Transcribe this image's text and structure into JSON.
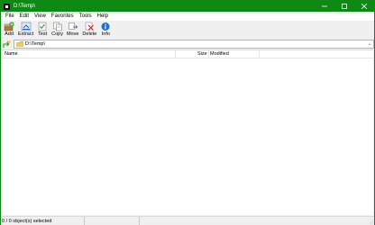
{
  "window": {
    "title": "D:\\Temp\\",
    "controls": [
      "minimize",
      "maximize",
      "close"
    ]
  },
  "menu": {
    "items": [
      "File",
      "Edit",
      "View",
      "Favorites",
      "Tools",
      "Help"
    ]
  },
  "toolbar": {
    "buttons": [
      {
        "label": "Add",
        "icon": "add-icon"
      },
      {
        "label": "Extract",
        "icon": "extract-icon"
      },
      {
        "label": "Test",
        "icon": "test-icon"
      },
      {
        "label": "Copy",
        "icon": "copy-icon"
      },
      {
        "label": "Move",
        "icon": "move-icon"
      },
      {
        "label": "Delete",
        "icon": "delete-icon"
      },
      {
        "label": "Info",
        "icon": "info-icon"
      }
    ]
  },
  "address": {
    "path": "D:\\Temp\\"
  },
  "list": {
    "columns": [
      "Name",
      "Size",
      "Modified"
    ]
  },
  "status": {
    "text": "0 / 0 object(s) selected"
  },
  "colors": {
    "titlebar": "#0e8a14"
  }
}
